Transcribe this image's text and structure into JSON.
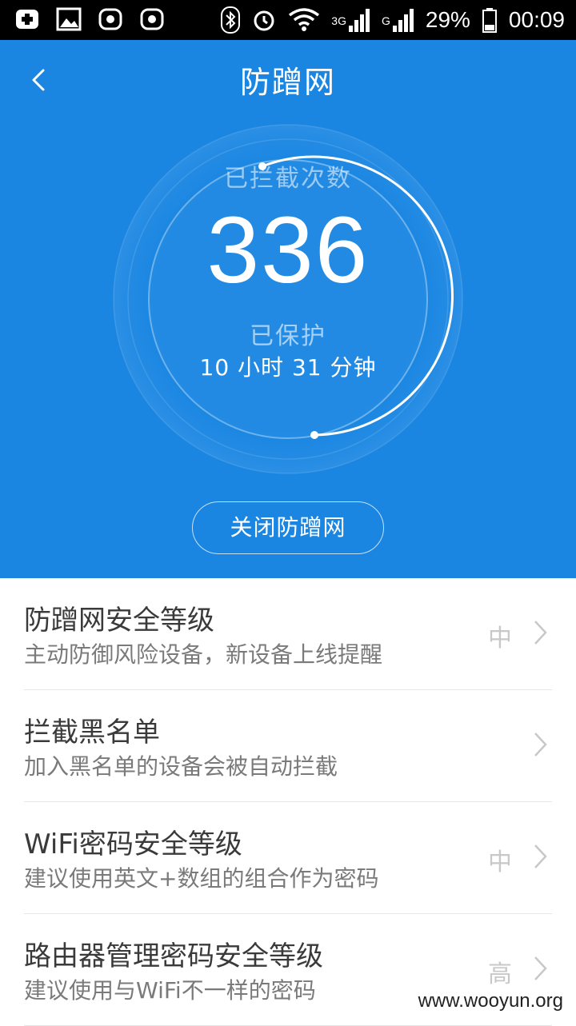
{
  "status_bar": {
    "network_3g": "3G",
    "network_g": "G",
    "battery": "29%",
    "time": "00:09"
  },
  "header": {
    "title": "防蹭网",
    "back_icon": "chevron-left-icon"
  },
  "stats": {
    "blocked_label": "已拦截次数",
    "blocked_count": "336",
    "protected_label": "已保护",
    "protected_time": "10 小时 31 分钟"
  },
  "toggle_button": "关闭防蹭网",
  "settings": [
    {
      "title": "防蹭网安全等级",
      "subtitle": "主动防御风险设备，新设备上线提醒",
      "level": "中"
    },
    {
      "title": "拦截黑名单",
      "subtitle": "加入黑名单的设备会被自动拦截",
      "level": ""
    },
    {
      "title": "WiFi密码安全等级",
      "subtitle": "建议使用英文+数组的组合作为密码",
      "level": "中"
    },
    {
      "title": "路由器管理密码安全等级",
      "subtitle": "建议使用与WiFi不一样的密码",
      "level": "高"
    }
  ],
  "watermark": "www.wooyun.org",
  "colors": {
    "header_bg": "#1a86e2",
    "text_primary": "#3a3a3a",
    "text_secondary": "#7a7a7a"
  }
}
